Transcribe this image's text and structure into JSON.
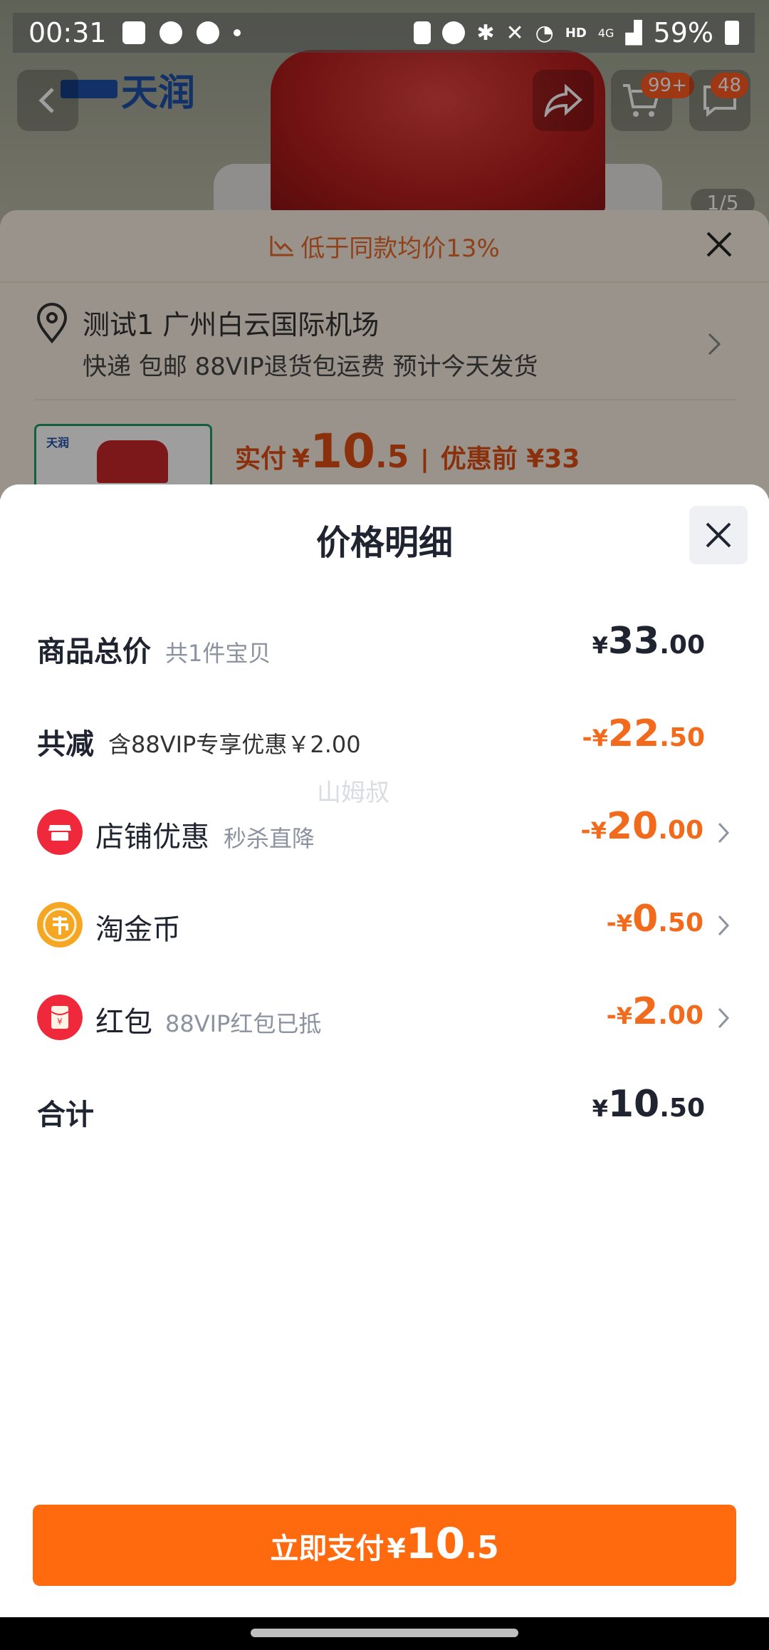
{
  "status_bar": {
    "time": "00:31",
    "network": "4G",
    "hd": "HD",
    "battery": "59%"
  },
  "background_page": {
    "brand": "天润",
    "cart_badge": "99+",
    "message_badge": "48",
    "image_counter": "1/5"
  },
  "middle_sheet": {
    "banner": "低于同款均价13%",
    "address": "测试1 广州白云国际机场",
    "shipping": "快递 包邮 88VIP退货包运费 预计今天发货",
    "price": {
      "label": "实付",
      "yen": "¥",
      "integer": "10",
      "decimal": ".5",
      "separator": "|",
      "before": "优惠前 ¥33"
    }
  },
  "sheet": {
    "title": "价格明细",
    "rows": {
      "total": {
        "label": "商品总价",
        "note": "共1件宝贝",
        "sign": "",
        "yen": "¥",
        "integer": "33",
        "decimal": ".00"
      },
      "reduce": {
        "label": "共减",
        "note": "含88VIP专享优惠￥2.00",
        "sign": "-",
        "yen": "¥",
        "integer": "22",
        "decimal": ".50"
      },
      "shop": {
        "label": "店铺优惠",
        "note": "秒杀直降",
        "sign": "-",
        "yen": "¥",
        "integer": "20",
        "decimal": ".00",
        "icon": "shop-icon",
        "icon_color": "#f0283c"
      },
      "coin": {
        "label": "淘金币",
        "note": "",
        "sign": "-",
        "yen": "¥",
        "integer": "0",
        "decimal": ".50",
        "icon": "coin-icon",
        "icon_color": "#f5a623"
      },
      "redpacket": {
        "label": "红包",
        "note": "88VIP红包已抵",
        "sign": "-",
        "yen": "¥",
        "integer": "2",
        "decimal": ".00",
        "icon": "red-packet-icon",
        "icon_color": "#f0283c"
      },
      "sum": {
        "label": "合计",
        "sign": "",
        "yen": "¥",
        "integer": "10",
        "decimal": ".50"
      }
    },
    "watermark": "山姆叔"
  },
  "pay_button": {
    "label": "立即支付",
    "yen": "¥",
    "integer": "10",
    "decimal": ".5"
  },
  "colors": {
    "accent_orange": "#ff6a0e",
    "discount_orange": "#f26b1d",
    "text_dark": "#1f2430",
    "text_muted": "#8c93a0"
  }
}
